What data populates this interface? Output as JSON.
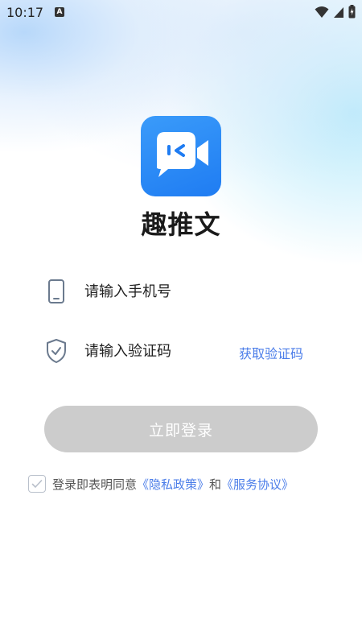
{
  "status_bar": {
    "time": "10:17",
    "notification_letter": "A"
  },
  "app": {
    "name": "趣推文"
  },
  "form": {
    "phone_placeholder": "请输入手机号",
    "code_placeholder": "请输入验证码",
    "get_code_label": "获取验证码",
    "login_label": "立即登录"
  },
  "agreement": {
    "prefix": "登录即表明同意",
    "privacy_link": "《隐私政策》",
    "conjunction": "和",
    "service_link": "《服务协议》"
  },
  "icons": {
    "logo": "video-chat-bubble-icon",
    "phone": "phone-icon",
    "shield": "shield-check-icon",
    "checkbox": "check-icon"
  },
  "colors": {
    "brand_blue": "#2385f5",
    "link_blue": "#4b7de9",
    "button_disabled": "#cccccc"
  }
}
